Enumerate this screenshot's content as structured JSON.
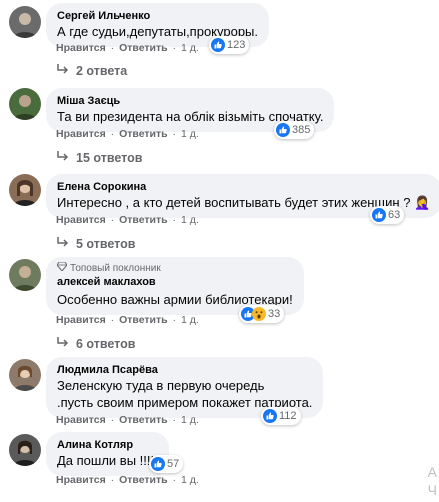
{
  "actions": {
    "like": "Нравится",
    "reply": "Ответить",
    "dot": "·"
  },
  "comments": [
    {
      "author": "Сергей Ильченко",
      "text_lines": [
        "А где судьи,депутаты,прокуроры."
      ],
      "age": "1 д.",
      "reactions": "123",
      "replies": "2 ответа",
      "avatar_color": "#6b6b6b"
    },
    {
      "author": "Міша Заєць",
      "text_lines": [
        "Та ви президента на облік візьміть спочатку."
      ],
      "age": "1 д.",
      "reactions": "385",
      "replies": "15 ответов",
      "avatar_color": "#4a6b3c"
    },
    {
      "author": "Елена Сорокина",
      "text_lines": [
        "Интересно , а кто детей воспитывать будет этих женщин ?"
      ],
      "emoji": "🤦‍♀️",
      "age": "1 д.",
      "reactions": "63",
      "replies": "5 ответов",
      "avatar_color": "#8a6d57"
    },
    {
      "badge": "Топовый поклонник",
      "author": "алексей маклахов",
      "text_lines": [
        "Особенно важны армии библиотекари!"
      ],
      "age": "1 д.",
      "reactions": "33",
      "replies": "6 ответов",
      "avatar_color": "#6f7b5e"
    },
    {
      "author": "Людмила Псарёва",
      "text_lines": [
        "Зеленскую туда в первую очередь",
        ".пусть своим примером покажет патриота."
      ],
      "age": "1 д.",
      "reactions": "112",
      "avatar_color": "#8d7a6a"
    },
    {
      "author": "Алина Котляр",
      "text_lines": [
        "Да пошли вы !!!!!"
      ],
      "age": "1 д.",
      "reactions": "57",
      "avatar_color": "#5a5a5a"
    }
  ],
  "side_glyphs": [
    "A",
    "Ч"
  ]
}
